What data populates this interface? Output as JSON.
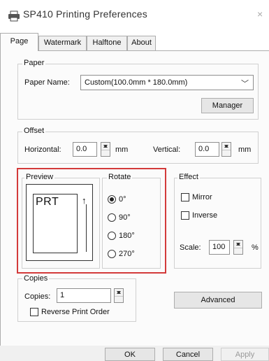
{
  "window": {
    "title": "SP410 Printing Preferences",
    "close_glyph": "×"
  },
  "tabs": [
    "Page",
    "Watermark",
    "Halftone",
    "About"
  ],
  "paper": {
    "legend": "Paper",
    "name_label": "Paper Name:",
    "selected": "Custom(100.0mm * 180.0mm)",
    "manager_label": "Manager"
  },
  "offset": {
    "legend": "Offset",
    "horizontal_label": "Horizontal:",
    "horizontal_value": "0.0",
    "horizontal_unit": "mm",
    "vertical_label": "Vertical:",
    "vertical_value": "0.0",
    "vertical_unit": "mm"
  },
  "preview": {
    "legend": "Preview",
    "page_text": "PRT",
    "arrow": "↑"
  },
  "rotate": {
    "legend": "Rotate",
    "options": [
      "0°",
      "90°",
      "180°",
      "270°"
    ],
    "selected": "0°"
  },
  "effect": {
    "legend": "Effect",
    "mirror_label": "Mirror",
    "inverse_label": "Inverse",
    "scale_label": "Scale:",
    "scale_value": "100",
    "scale_unit": "%"
  },
  "copies": {
    "legend": "Copies",
    "copies_label": "Copies:",
    "copies_value": "1",
    "reverse_label": "Reverse Print Order"
  },
  "buttons": {
    "advanced": "Advanced",
    "ok": "OK",
    "cancel": "Cancel",
    "apply": "Apply"
  },
  "colors": {
    "highlight": "#d33a3a"
  }
}
